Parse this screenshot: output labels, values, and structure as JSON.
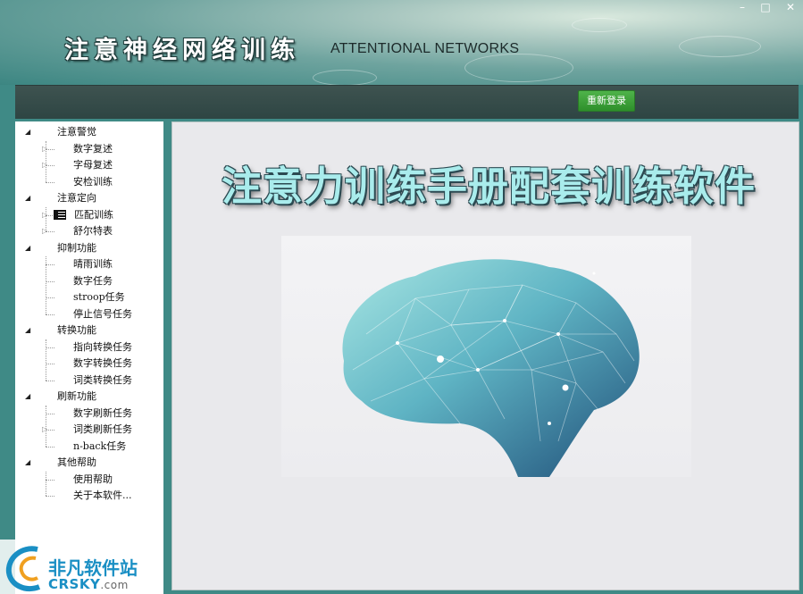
{
  "header": {
    "title": "注意神经网络训练",
    "subtitle": "ATTENTIONAL NETWORKS"
  },
  "window_controls": {
    "minimize": "–",
    "maximize": "□",
    "close": "✕"
  },
  "toolbar": {
    "relogin_label": "重新登录"
  },
  "sidebar": {
    "categories": [
      {
        "label": "注意警觉",
        "items": [
          "数字复述",
          "字母复述",
          "安检训练"
        ]
      },
      {
        "label": "注意定向",
        "items": [
          "匹配训练",
          "舒尔特表"
        ]
      },
      {
        "label": "抑制功能",
        "items": [
          "晴雨训练",
          "数字任务",
          "stroop任务",
          "停止信号任务"
        ]
      },
      {
        "label": "转换功能",
        "items": [
          "指向转换任务",
          "数字转换任务",
          "词类转换任务"
        ]
      },
      {
        "label": "刷新功能",
        "items": [
          "数字刷新任务",
          "词类刷新任务",
          "n-back任务"
        ]
      },
      {
        "label": "其他帮助",
        "items": [
          "使用帮助",
          "关于本软件..."
        ]
      }
    ]
  },
  "main": {
    "banner": "注意力训练手册配套训练软件"
  },
  "watermark": {
    "name": "非凡软件站",
    "domain": "CRSKY",
    "tld": ".com"
  },
  "colors": {
    "frame": "#3f8a86",
    "toolbar": "#34494a",
    "button": "#3aa035",
    "banner": "#a9ecec"
  }
}
